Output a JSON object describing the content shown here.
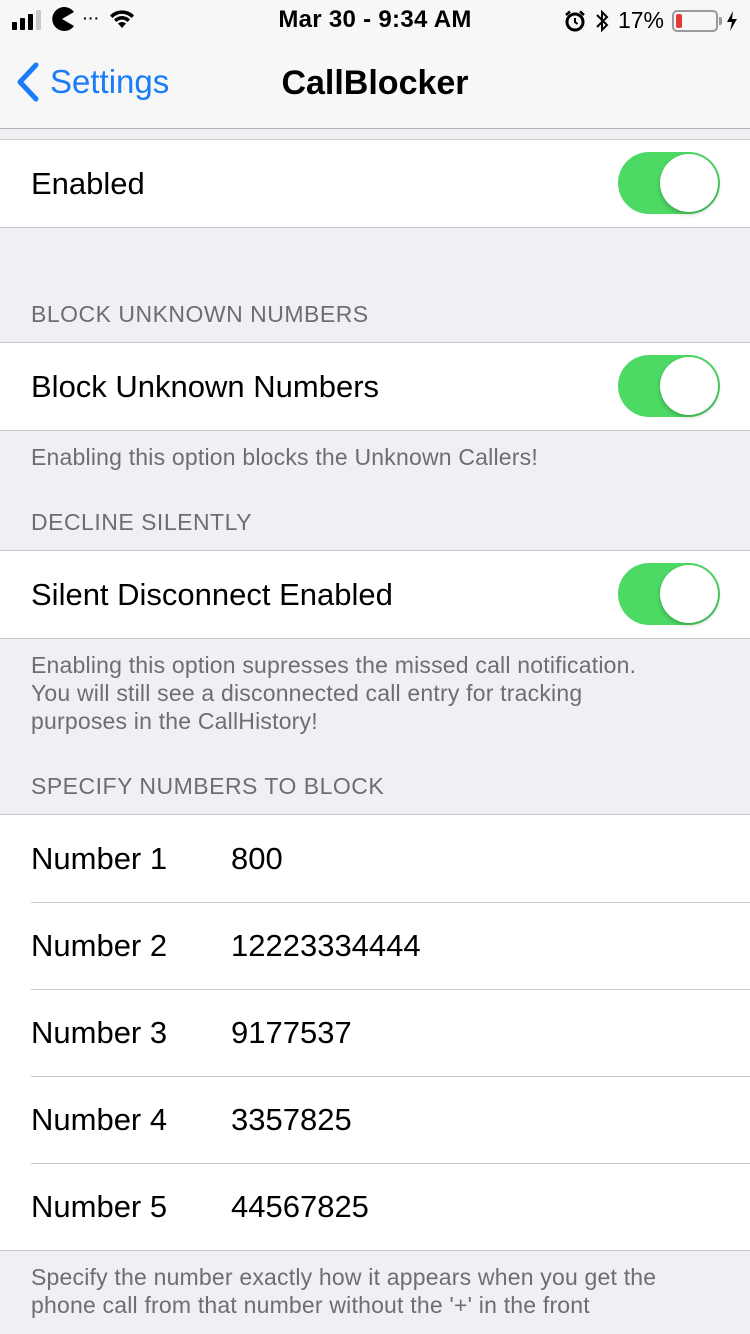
{
  "status": {
    "time": "Mar 30 - 9:34 AM",
    "battery": "17%",
    "battery_level": 0.17
  },
  "nav": {
    "back_label": "Settings",
    "title": "CallBlocker"
  },
  "enabled": {
    "label": "Enabled",
    "on": true
  },
  "block_unknown": {
    "header": "BLOCK UNKNOWN NUMBERS",
    "label": "Block Unknown Numbers",
    "on": true,
    "footer": "Enabling this option blocks the Unknown Callers!"
  },
  "decline_silently": {
    "header": "DECLINE SILENTLY",
    "label": "Silent Disconnect Enabled",
    "on": true,
    "footer_lines": [
      "Enabling this option supresses the missed call notification.",
      "You will still see a disconnected call entry for tracking",
      "purposes in the CallHistory!"
    ]
  },
  "numbers": {
    "header": "SPECIFY NUMBERS TO BLOCK",
    "items": [
      {
        "label": "Number 1",
        "value": "800"
      },
      {
        "label": "Number 2",
        "value": "12223334444"
      },
      {
        "label": "Number 3",
        "value": "9177537"
      },
      {
        "label": "Number 4",
        "value": "3357825"
      },
      {
        "label": "Number 5",
        "value": "44567825"
      }
    ],
    "footer_lines": [
      "Specify the number exactly how it appears when you get the",
      "phone call from that number without the '+' in the front"
    ]
  },
  "colors": {
    "accent": "#1a7cf6",
    "toggle_on": "#4cd964",
    "background": "#efeff4"
  }
}
